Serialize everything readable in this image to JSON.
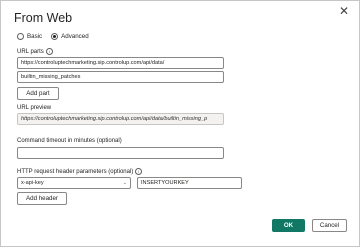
{
  "dialog": {
    "title": "From Web",
    "close_glyph": "✕"
  },
  "mode": {
    "options": [
      {
        "label": "Basic",
        "selected": false
      },
      {
        "label": "Advanced",
        "selected": true
      }
    ]
  },
  "url_parts": {
    "label": "URL parts",
    "info_glyph": "i",
    "parts": [
      "https://controluptechmarketing.sip.controlup.com/api/data/",
      "builtin_missing_patches"
    ],
    "add_part_label": "Add part"
  },
  "url_preview": {
    "label": "URL preview",
    "value": "https://controluptechmarketing.sip.controlup.com/api/data/builtin_missing_p"
  },
  "timeout": {
    "label": "Command timeout in minutes (optional)",
    "value": ""
  },
  "headers": {
    "label": "HTTP request header parameters (optional)",
    "info_glyph": "i",
    "key_selected": "x-api-key",
    "chevron_glyph": "⌄",
    "value": "INSERTYOURKEY",
    "add_header_label": "Add header"
  },
  "footer": {
    "ok_label": "OK",
    "cancel_label": "Cancel"
  }
}
